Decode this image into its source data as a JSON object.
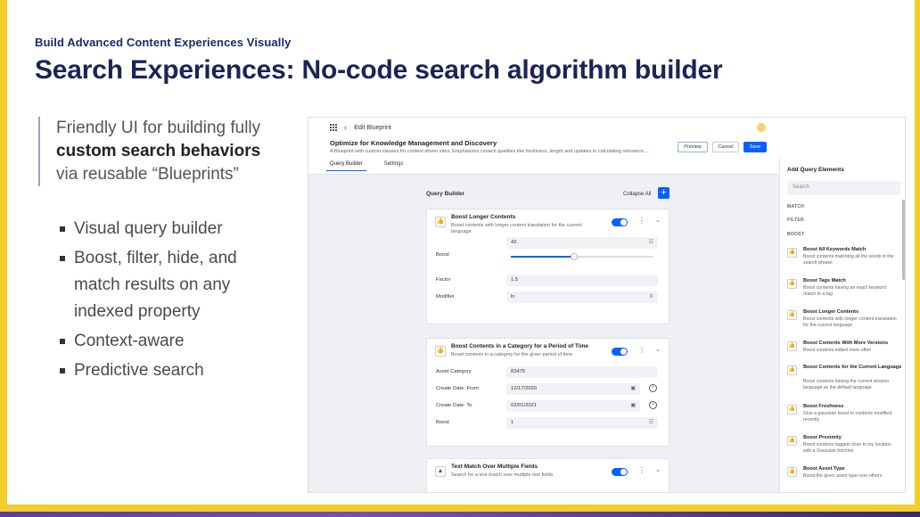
{
  "slide": {
    "kicker": "Build  Advanced Content Experiences Visually",
    "title": "Search Experiences: No-code search algorithm builder",
    "quote": {
      "line1": "Friendly UI for building fully",
      "line2": "custom search behaviors",
      "line3": "via reusable “Blueprints”"
    },
    "bullets": [
      "Visual query builder",
      "Boost, filter, hide, and match results on any indexed property",
      "Context-aware",
      "Predictive search"
    ]
  },
  "app": {
    "breadcrumb": "Edit Blueprint",
    "header_title": "Optimize for Knowledge Management and Discovery",
    "header_desc": "A Blueprint with custom clauses for content driven sites. Emphasizes content qualities like freshness, length and updates in calculating relevance....",
    "buttons": {
      "preview": "Preview",
      "cancel": "Cancel",
      "save": "Save"
    },
    "tabs": [
      "Query Builder",
      "Settings"
    ],
    "query_builder_label": "Query Builder",
    "collapse_all": "Collapse All",
    "add": "+",
    "cards": [
      {
        "title": "Boost Longer Contents",
        "desc": "Boost contents with longer content translation for the current language",
        "rows": [
          {
            "label": "Boost",
            "value": "42"
          },
          {
            "label": "Factor",
            "value": "1.5"
          },
          {
            "label": "Modifier",
            "value": "ln"
          }
        ]
      },
      {
        "title": "Boost Contents in a Category for a Period of Time",
        "desc": "Boost contents in a category for the given period of time",
        "rows": [
          {
            "label": "Asset Category",
            "value": "83475"
          },
          {
            "label": "Create Date: From",
            "value": "12/17/2020"
          },
          {
            "label": "Create Date: To",
            "value": "02/01/2021"
          },
          {
            "label": "Boost",
            "value": "1"
          }
        ]
      },
      {
        "title": "Text Match Over Multiple Fields",
        "desc": "Search for a text match over multiple text fields"
      }
    ],
    "side": {
      "title": "Add Query Elements",
      "search_placeholder": "Search",
      "sections": [
        "MATCH",
        "FILTER",
        "BOOST"
      ],
      "items": [
        {
          "title": "Boost All Keywords Match",
          "desc": "Boost contents matching all the words in the search phrase"
        },
        {
          "title": "Boost Tags Match",
          "desc": "Boost contents having an exact keyword match to a tag"
        },
        {
          "title": "Boost Longer Contents",
          "desc": "Boost contents with longer content translation for the current language"
        },
        {
          "title": "Boost Contents With More Versions",
          "desc": "Boost contents edited more often"
        },
        {
          "title": "Boost Contents for the Current Language",
          "desc": "Boost contents having the current session language as the default language"
        },
        {
          "title": "Boost Freshness",
          "desc": "Give a gaussian boost to contents modified recently"
        },
        {
          "title": "Boost Proximity",
          "desc": "Boost contents tagged close to my location with a Gaussian function"
        },
        {
          "title": "Boost Asset Type",
          "desc": "Boost the given asset type over others"
        }
      ]
    }
  }
}
